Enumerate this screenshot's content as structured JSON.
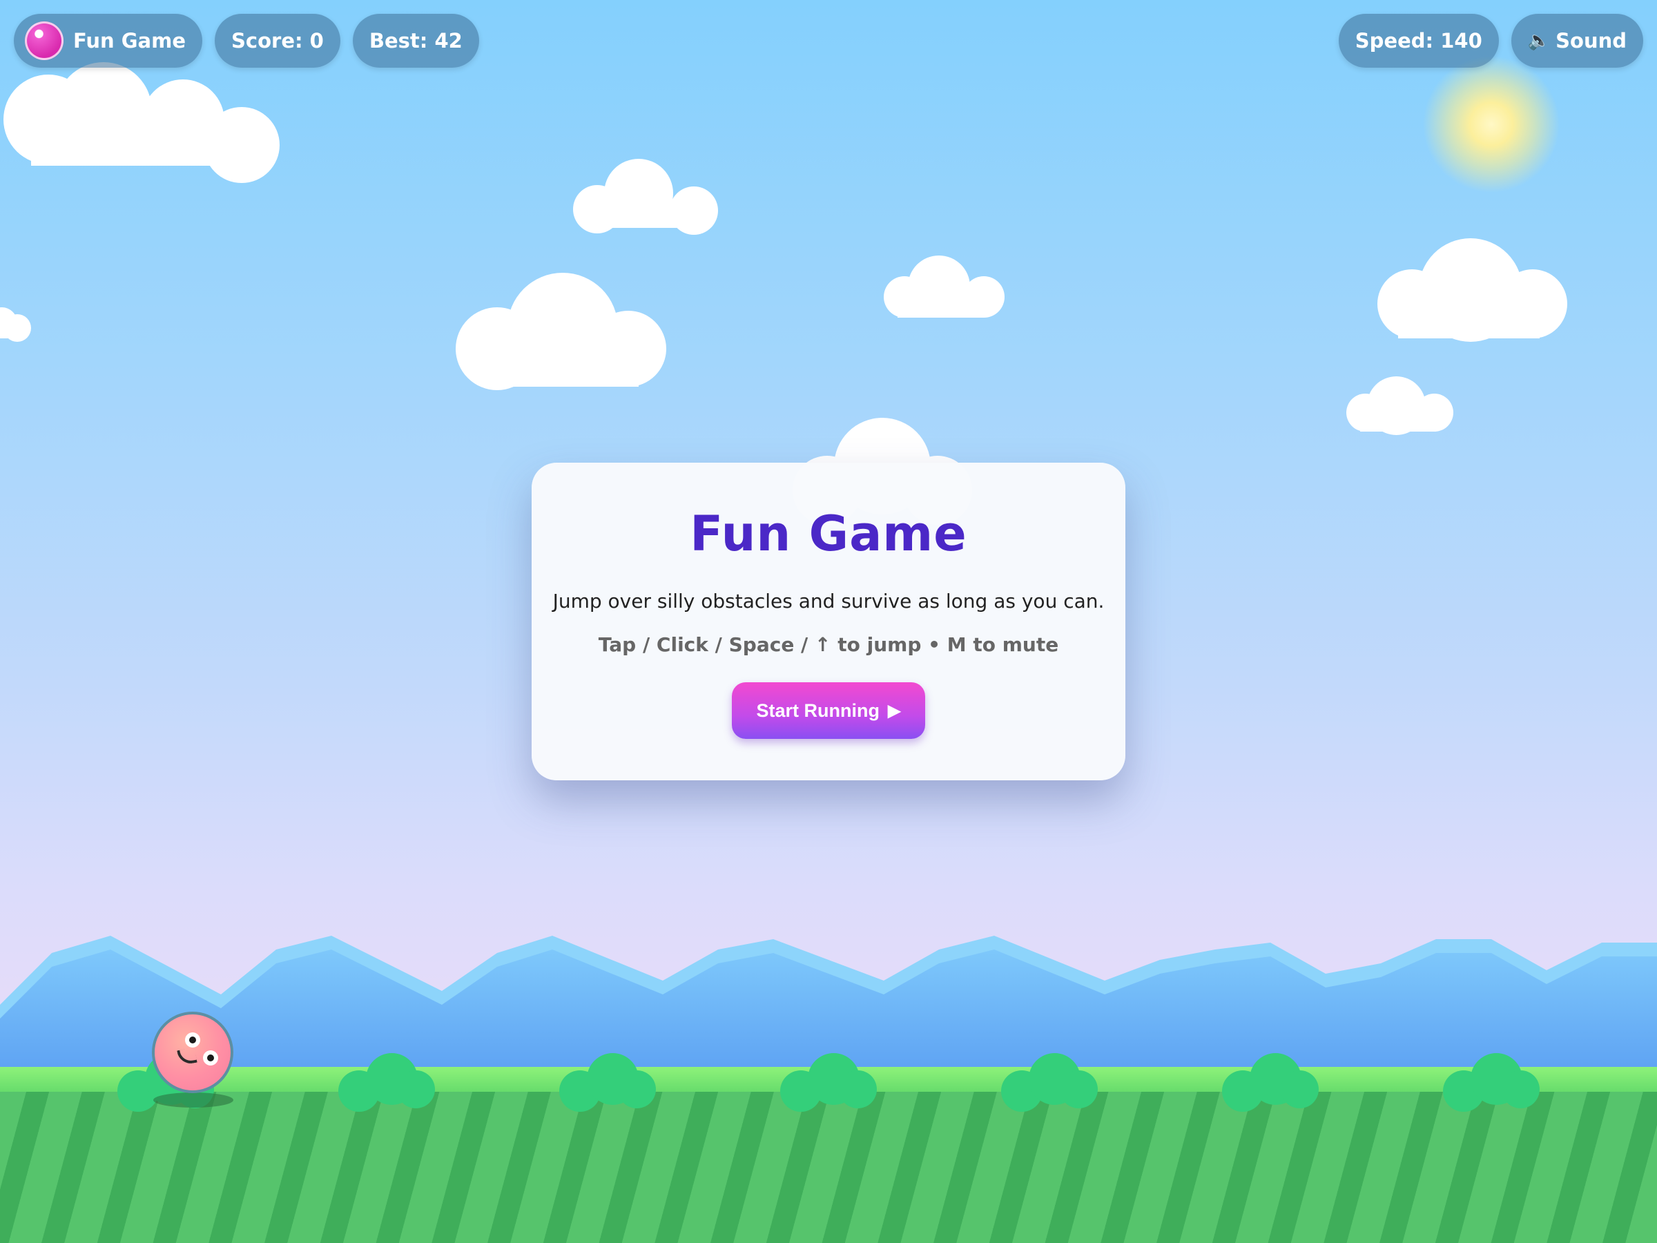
{
  "hud": {
    "title": "Fun Game",
    "score": "Score: 0",
    "best": "Best: 42",
    "speed": "Speed: 140",
    "sound": "Sound",
    "sound_icon": "speaker-icon"
  },
  "modal": {
    "title": "Fun Game",
    "description": "Jump over silly obstacles and survive as long as you can.",
    "controls": "Tap / Click / Space / ↑ to jump • M to mute",
    "start_button": "Start Running",
    "start_icon": "play-icon"
  },
  "colors": {
    "sky_top": "#84d0fd",
    "sky_bottom": "#e4dcf9",
    "title": "#4b28c7",
    "button": "#d94ae0",
    "grass": "#56c46c",
    "bush": "#34cf7a",
    "mountain": "#5ea9f5"
  }
}
